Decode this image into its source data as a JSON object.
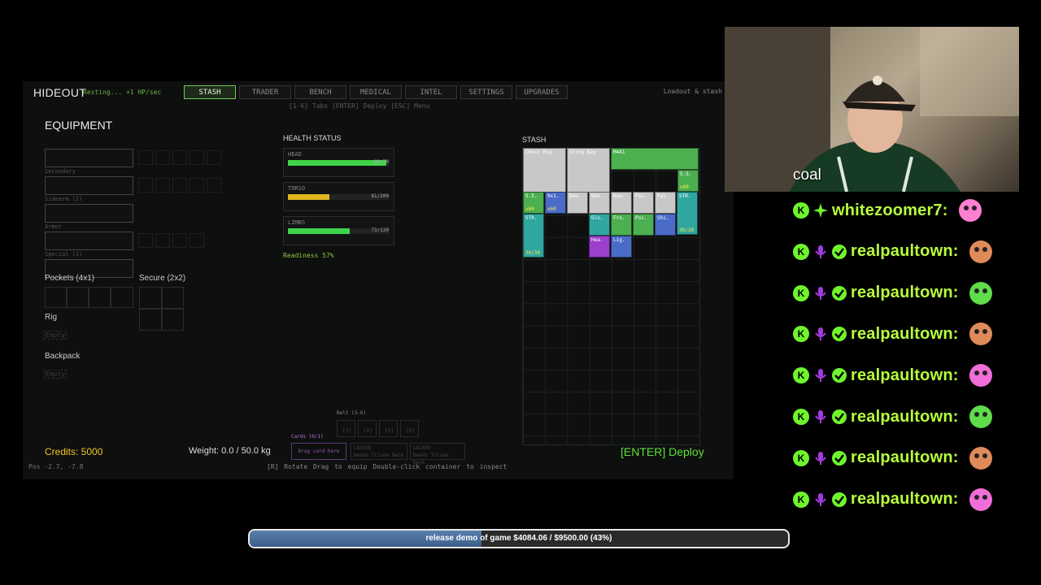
{
  "game": {
    "title": "HIDEOUT",
    "subtitle": "Resting... +1 HP/sec",
    "tabs": [
      "STASH",
      "TRADER",
      "BENCH",
      "MEDICAL",
      "INTEL",
      "SETTINGS",
      "UPGRADES"
    ],
    "active_tab": "STASH",
    "hint": "[1-6] Tabs  [ENTER] Deploy  [ESC] Menu",
    "top_right": "Loadout & stash"
  },
  "equipment": {
    "heading": "EQUIPMENT",
    "labels": [
      "Secondary",
      "Sidearm (2)",
      "Armor",
      "Special (1)"
    ],
    "pockets_label": "Pockets (4x1)",
    "secure_label": "Secure (2x2)",
    "rig_label": "Rig",
    "rig_empty": "Empty",
    "backpack_label": "Backpack",
    "backpack_empty": "Empty"
  },
  "health": {
    "heading": "HEALTH STATUS",
    "parts": [
      {
        "name": "HEAD",
        "value": "68/70",
        "pct": 0.97,
        "color": "#3ed34a"
      },
      {
        "name": "TORSO",
        "value": "81/200",
        "pct": 0.405,
        "color": "#e0b71f"
      },
      {
        "name": "LIMBS",
        "value": "73/120",
        "pct": 0.61,
        "color": "#3ed34a"
      }
    ],
    "readiness": "Readiness 57%"
  },
  "stash": {
    "heading": "STASH",
    "items": [
      {
        "label": "Chest Rig",
        "color": "#c8c8c8"
      },
      {
        "label": "Sling Bag",
        "color": "#c8c8c8"
      },
      {
        "label": "M4A1",
        "color": "#4caf50"
      },
      {
        "label": "5.5.",
        "qty": "x60",
        "color": "#4caf50"
      },
      {
        "label": "5.5.",
        "qty": "x60",
        "color": "#4caf50"
      },
      {
        "label": "9x1.",
        "qty": "x60",
        "color": "#4a6cc8"
      },
      {
        "label": "Ban.",
        "color": "#c8c8c8"
      },
      {
        "label": "Ban.",
        "color": "#c8c8c8"
      },
      {
        "label": "Ban.",
        "color": "#c8c8c8"
      },
      {
        "label": "Pai.",
        "color": "#c8c8c8"
      },
      {
        "label": "Pai.",
        "color": "#c8c8c8"
      },
      {
        "label": "STR.",
        "qty": "30/30",
        "color": "#2fa6a0"
      },
      {
        "label": "STR.",
        "qty": "30/30",
        "color": "#2fa6a0"
      },
      {
        "label": "Glo.",
        "color": "#2fa6a0"
      },
      {
        "label": "Fro.",
        "color": "#4caf50"
      },
      {
        "label": "Poi.",
        "color": "#4caf50"
      },
      {
        "label": "Shi.",
        "color": "#4a6cc8"
      },
      {
        "label": "Hea.",
        "color": "#9c3fcc"
      },
      {
        "label": "Lig.",
        "color": "#4a6cc8"
      }
    ]
  },
  "footer": {
    "belt": "Belt (3-6)",
    "belt_slots": [
      "[3]",
      "[4]",
      "[5]",
      "[6]"
    ],
    "cards": "Cards (0/1)",
    "drag_card": "Drag card here",
    "locked1": "LOCKED",
    "locked1_sub": "Needs Triune Deck",
    "locked2": "LOCKED",
    "locked2_sub": "Needs Triune Deck",
    "credits": "Credits: 5000",
    "pos": "Pos -2.7, -7.8",
    "weight": "Weight: 0.0 / 50.0 kg",
    "hints": "[R] Rotate   Drag to equip   Double-click container to inspect",
    "deploy": "[ENTER] Deploy"
  },
  "stream": {
    "webcam_name": "coal",
    "chat": [
      {
        "user": "whitezoomer7:"
      },
      {
        "user": "realpaultown:"
      },
      {
        "user": "realpaultown:"
      },
      {
        "user": "realpaultown:"
      },
      {
        "user": "realpaultown:"
      },
      {
        "user": "realpaultown:"
      },
      {
        "user": "realpaultown:"
      },
      {
        "user": "realpaultown:"
      }
    ],
    "goal_text": "release demo of game $4084.06 / $9500.00 (43%)",
    "goal_progress": 0.43,
    "accent": "#b8ff3b"
  }
}
